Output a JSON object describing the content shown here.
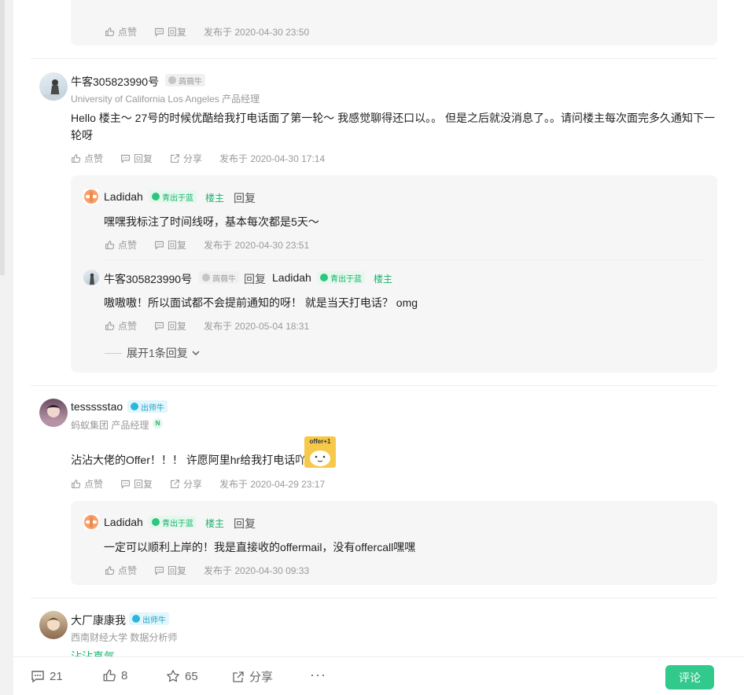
{
  "top_reply": {
    "like": "点赞",
    "reply": "回复",
    "time": "发布于 2020-04-30 23:50"
  },
  "comments": [
    {
      "name": "牛客305823990号",
      "badge": "蒟蒻牛",
      "sub": "University of California Los Angeles 产品经理",
      "content": "Hello 楼主～ 27号的时候优酷给我打电话面了第一轮～ 我感觉聊得还口以。。 但是之后就没消息了。。请问楼主每次面完多久通知下一轮呀",
      "like": "点赞",
      "reply": "回复",
      "share": "分享",
      "time": "发布于 2020-04-30 17:14",
      "replies": [
        {
          "name": "Ladidah",
          "badge": "青出于蓝",
          "tag": "楼主",
          "reply_word": "回复",
          "content": "嘿嘿我标注了时间线呀，基本每次都是5天～",
          "like": "点赞",
          "reply": "回复",
          "time": "发布于 2020-04-30 23:51"
        },
        {
          "name": "牛客305823990号",
          "badge": "蒟蒻牛",
          "reply_word": "回复",
          "target": "Ladidah",
          "target_badge": "青出于蓝",
          "target_tag": "楼主",
          "content": "嗷嗷嗷！所以面试都不会提前通知的呀！ 就是当天打电话？ omg",
          "like": "点赞",
          "reply": "回复",
          "time": "发布于 2020-05-04 18:31"
        }
      ],
      "expand": "展开1条回复"
    },
    {
      "name": "tessssstao",
      "badge": "出师牛",
      "sub": "蚂蚁集团 产品经理",
      "sub_badge": "N",
      "content": "沾沾大佬的Offer！！！ 许愿阿里hr给我打电话吖",
      "sticker_text": "offer+1",
      "like": "点赞",
      "reply": "回复",
      "share": "分享",
      "time": "发布于 2020-04-29 23:17",
      "replies": [
        {
          "name": "Ladidah",
          "badge": "青出于蓝",
          "tag": "楼主",
          "reply_word": "回复",
          "content": "一定可以顺利上岸的！我是直接收的offermail，没有offercall嘿嘿",
          "like": "点赞",
          "reply": "回复",
          "time": "发布于 2020-04-30 09:33"
        }
      ]
    },
    {
      "name": "大厂康康我",
      "badge": "出师牛",
      "sub": "西南财经大学 数据分析师",
      "content": "沾沾喜气"
    }
  ],
  "bottom_bar": {
    "comments": "21",
    "likes": "8",
    "stars": "65",
    "share": "分享",
    "more": "···",
    "comment_button": "评论"
  },
  "colors": {
    "accent": "#32c98c",
    "badge_green": "#18b36c",
    "badge_teal": "#1aa3c9",
    "ladidah_orange": "#f08a4b"
  },
  "icons": [
    "thumb-up-icon",
    "reply-bubble-icon",
    "share-icon",
    "star-icon",
    "more-icon",
    "chevron-down-icon"
  ]
}
